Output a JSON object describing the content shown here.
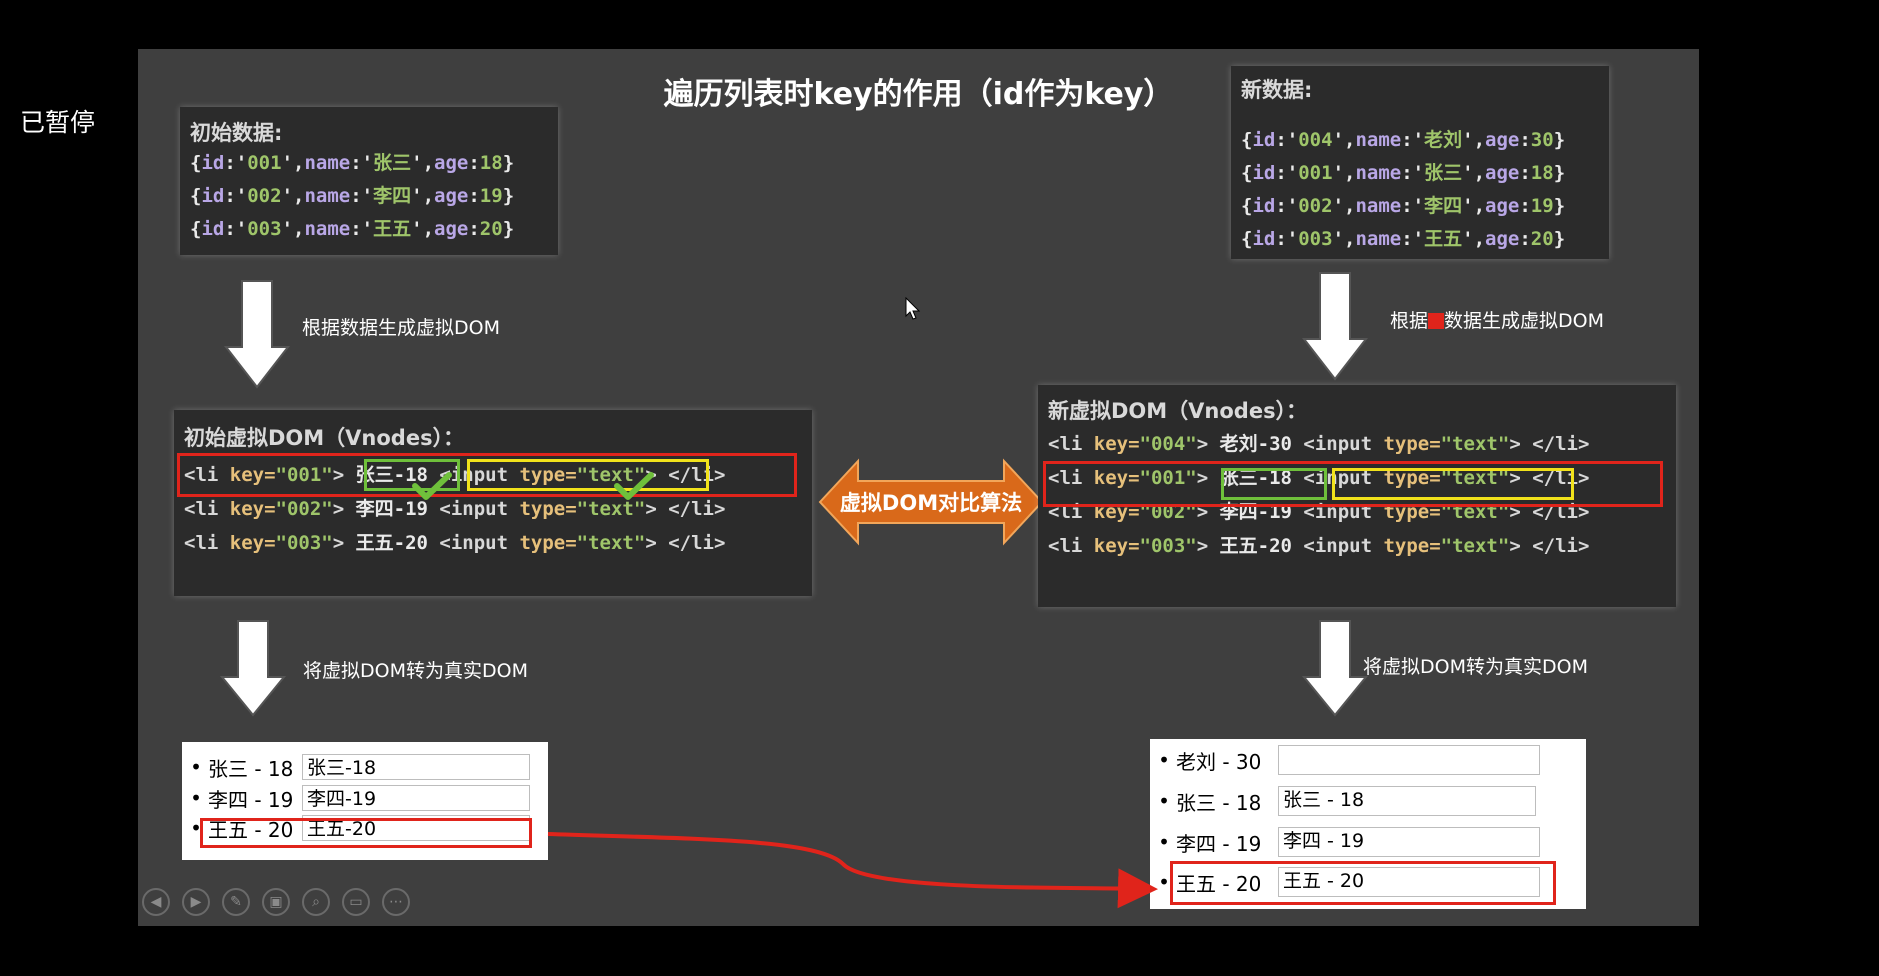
{
  "status": "已暂停",
  "slide": {
    "title": "遍历列表时key的作用（id作为key）",
    "initial_data": {
      "heading": "初始数据:",
      "rows": [
        {
          "id": "001",
          "name": "张三",
          "age": "18"
        },
        {
          "id": "002",
          "name": "李四",
          "age": "19"
        },
        {
          "id": "003",
          "name": "王五",
          "age": "20"
        }
      ]
    },
    "new_data": {
      "heading": "新数据:",
      "rows": [
        {
          "id": "004",
          "name": "老刘",
          "age": "30"
        },
        {
          "id": "001",
          "name": "张三",
          "age": "18"
        },
        {
          "id": "002",
          "name": "李四",
          "age": "19"
        },
        {
          "id": "003",
          "name": "王五",
          "age": "20"
        }
      ]
    },
    "note_gen_left": "根据数据生成虚拟DOM",
    "note_gen_right_pre": "根据",
    "note_gen_right_post": "数据生成虚拟DOM",
    "note_real_left": "将虚拟DOM转为真实DOM",
    "note_real_right": "将虚拟DOM转为真实DOM",
    "diff_label": "虚拟DOM对比算法",
    "initial_vdom": {
      "heading": "初始虚拟DOM（Vnodes）：",
      "rows": [
        {
          "key": "001",
          "text": "张三-18"
        },
        {
          "key": "002",
          "text": "李四-19"
        },
        {
          "key": "003",
          "text": "王五-20"
        }
      ]
    },
    "new_vdom": {
      "heading": "新虚拟DOM（Vnodes）：",
      "rows": [
        {
          "key": "004",
          "text": "老刘-30"
        },
        {
          "key": "001",
          "text": "张三-18"
        },
        {
          "key": "002",
          "text": "李四-19"
        },
        {
          "key": "003",
          "text": "王五-20"
        }
      ]
    },
    "code_tokens": {
      "li_open": "<li",
      "key_attr": " key=",
      "input_open": "<input",
      "type_attr": " type=",
      "type_val": "\"text\"",
      "tag_close": ">",
      "li_close": "</li>"
    },
    "real_dom_left": {
      "rows": [
        {
          "label": "张三 - 18",
          "input": "张三-18"
        },
        {
          "label": "李四 - 19",
          "input": "李四-19"
        },
        {
          "label": "王五 - 20",
          "input": "王五-20"
        }
      ]
    },
    "real_dom_right": {
      "rows": [
        {
          "label": "老刘 - 30",
          "input": ""
        },
        {
          "label": "张三 - 18",
          "input": "张三 - 18"
        },
        {
          "label": "李四 - 19",
          "input": "李四 - 19"
        },
        {
          "label": "王五 - 20",
          "input": "王五 - 20"
        }
      ]
    },
    "toolbar": [
      "prev-icon",
      "next-icon",
      "pen-icon",
      "slides-icon",
      "zoom-icon",
      "subtitle-icon",
      "more-icon"
    ],
    "colors": {
      "highlight_red": "#e0241b",
      "match_green": "#6fc03b",
      "match_yellow": "#f1e21b",
      "diff_orange": "#d9691a"
    }
  }
}
